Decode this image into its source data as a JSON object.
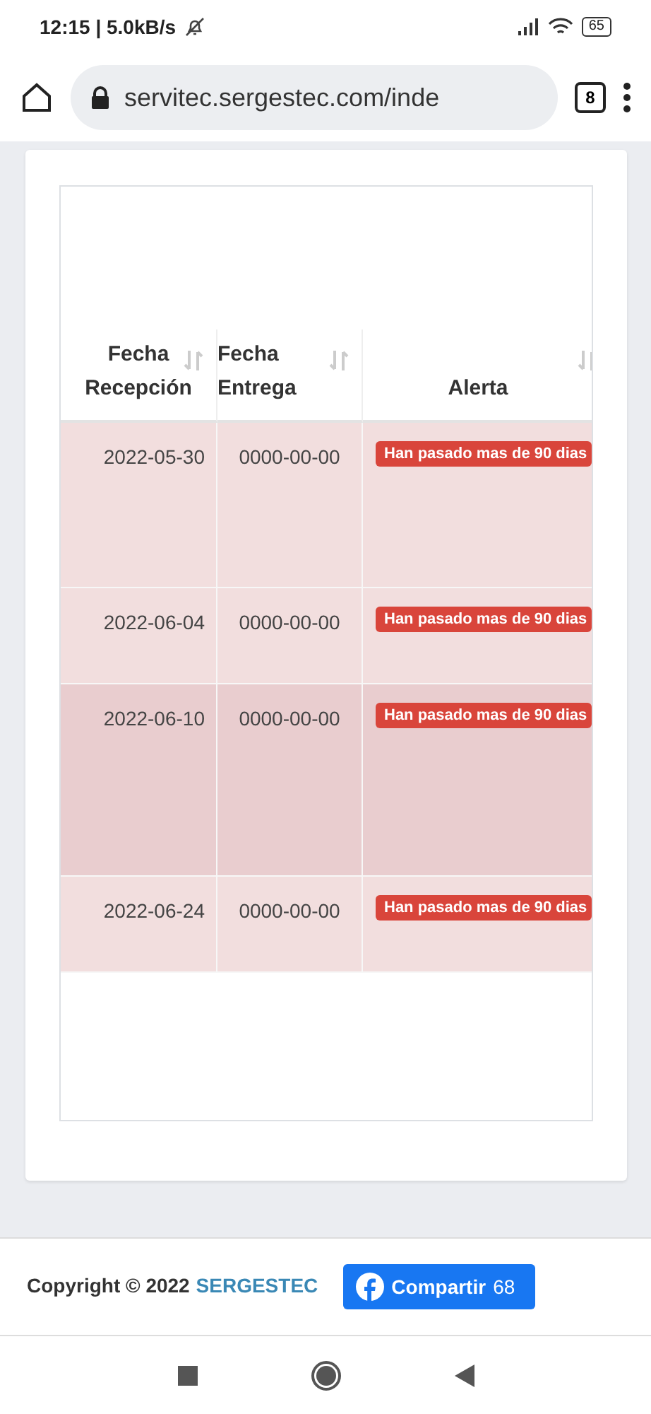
{
  "status_bar": {
    "time": "12:15 | 5.0kB/s",
    "battery": "65"
  },
  "browser": {
    "url": "servitec.sergestec.com/inde",
    "tab_count": "8"
  },
  "table": {
    "columns": [
      {
        "label": "Fecha Recepción",
        "sortable": true
      },
      {
        "label": "Fecha Entrega",
        "sortable": true
      },
      {
        "label": "Alerta",
        "sortable": true
      }
    ],
    "rows": [
      {
        "received": "2022-05-30",
        "delivered": "0000-00-00",
        "alert": "Han pasado mas de 90 dias",
        "selected": false
      },
      {
        "received": "2022-06-04",
        "delivered": "0000-00-00",
        "alert": "Han pasado mas de 90 dias",
        "selected": false
      },
      {
        "received": "2022-06-10",
        "delivered": "0000-00-00",
        "alert": "Han pasado mas de 90 dias",
        "selected": true
      },
      {
        "received": "2022-06-24",
        "delivered": "0000-00-00",
        "alert": "Han pasado mas de 90 dias",
        "selected": false
      }
    ]
  },
  "footer": {
    "copyright": "Copyright © 2022",
    "brand": "SERGESTEC",
    "share_label": "Compartir",
    "share_count": "68"
  }
}
